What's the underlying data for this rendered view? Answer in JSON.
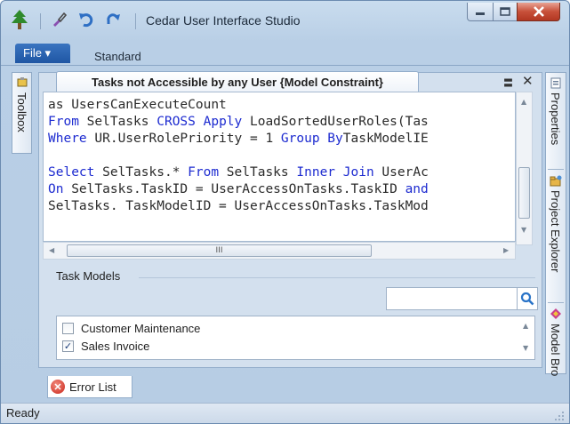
{
  "window": {
    "title": "Cedar User Interface Studio"
  },
  "ribbon": {
    "file_label": "File ▾",
    "tab_label": "Standard"
  },
  "left_panel": {
    "toolbox_label": "Toolbox"
  },
  "right_panel": {
    "items": [
      {
        "label": "Properties"
      },
      {
        "label": "Project Explorer"
      },
      {
        "label": "Model Bro"
      }
    ]
  },
  "document": {
    "tab_title": "Tasks not Accessible by any User {Model Constraint}",
    "menu_glyph": "〓",
    "close_glyph": "✕",
    "code_lines": [
      [
        {
          "t": "as UsersCanExecuteCount",
          "c": ""
        }
      ],
      [
        {
          "t": "From",
          "c": "kw"
        },
        {
          "t": " SelTasks ",
          "c": ""
        },
        {
          "t": "CROSS Apply",
          "c": "kw"
        },
        {
          "t": " LoadSortedUserRoles(Tas",
          "c": ""
        }
      ],
      [
        {
          "t": "Where",
          "c": "kw"
        },
        {
          "t": " UR.UserRolePriority = 1 ",
          "c": ""
        },
        {
          "t": "Group By",
          "c": "kw"
        },
        {
          "t": "TaskModelIE",
          "c": ""
        }
      ],
      [
        {
          "t": "",
          "c": ""
        }
      ],
      [
        {
          "t": "Select",
          "c": "kw"
        },
        {
          "t": " SelTasks.* ",
          "c": ""
        },
        {
          "t": "From",
          "c": "kw"
        },
        {
          "t": " SelTasks ",
          "c": ""
        },
        {
          "t": "Inner Join",
          "c": "kw"
        },
        {
          "t": " UserAc",
          "c": ""
        }
      ],
      [
        {
          "t": "On",
          "c": "kw"
        },
        {
          "t": " SelTasks.TaskID = UserAccessOnTasks.TaskID ",
          "c": ""
        },
        {
          "t": "and",
          "c": "kw"
        }
      ],
      [
        {
          "t": "SelTasks. TaskModelID = UserAccessOnTasks.TaskMod",
          "c": ""
        }
      ]
    ],
    "hscroll_grip": "III"
  },
  "task_models": {
    "label": "Task Models",
    "search_value": "",
    "items": [
      {
        "label": "Customer Maintenance",
        "checked": false
      },
      {
        "label": "Sales Invoice",
        "checked": true
      }
    ]
  },
  "error_list": {
    "label": "Error List"
  },
  "status": {
    "text": "Ready"
  },
  "colors": {
    "keyword": "#1d2bd0",
    "file_tab": "#2a64b3",
    "close_button": "#c7503a"
  },
  "icons": [
    "tree-icon",
    "brush-icon",
    "undo-icon",
    "redo-icon",
    "minimize-icon",
    "maximize-icon",
    "close-icon",
    "pin-icon",
    "properties-icon",
    "project-explorer-icon",
    "model-browser-icon",
    "search-icon",
    "error-icon",
    "resize-grip-icon"
  ]
}
